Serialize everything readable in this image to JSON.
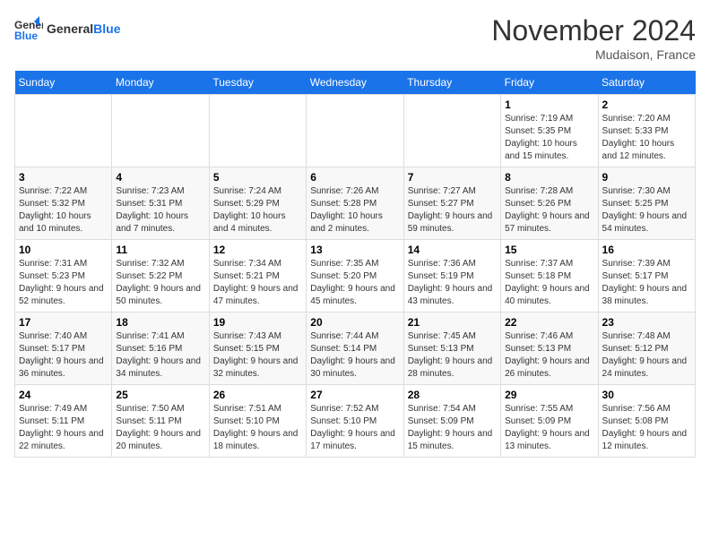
{
  "header": {
    "logo_general": "General",
    "logo_blue": "Blue",
    "month_title": "November 2024",
    "location": "Mudaison, France"
  },
  "calendar": {
    "days_of_week": [
      "Sunday",
      "Monday",
      "Tuesday",
      "Wednesday",
      "Thursday",
      "Friday",
      "Saturday"
    ],
    "weeks": [
      [
        {
          "day": "",
          "info": ""
        },
        {
          "day": "",
          "info": ""
        },
        {
          "day": "",
          "info": ""
        },
        {
          "day": "",
          "info": ""
        },
        {
          "day": "",
          "info": ""
        },
        {
          "day": "1",
          "info": "Sunrise: 7:19 AM\nSunset: 5:35 PM\nDaylight: 10 hours and 15 minutes."
        },
        {
          "day": "2",
          "info": "Sunrise: 7:20 AM\nSunset: 5:33 PM\nDaylight: 10 hours and 12 minutes."
        }
      ],
      [
        {
          "day": "3",
          "info": "Sunrise: 7:22 AM\nSunset: 5:32 PM\nDaylight: 10 hours and 10 minutes."
        },
        {
          "day": "4",
          "info": "Sunrise: 7:23 AM\nSunset: 5:31 PM\nDaylight: 10 hours and 7 minutes."
        },
        {
          "day": "5",
          "info": "Sunrise: 7:24 AM\nSunset: 5:29 PM\nDaylight: 10 hours and 4 minutes."
        },
        {
          "day": "6",
          "info": "Sunrise: 7:26 AM\nSunset: 5:28 PM\nDaylight: 10 hours and 2 minutes."
        },
        {
          "day": "7",
          "info": "Sunrise: 7:27 AM\nSunset: 5:27 PM\nDaylight: 9 hours and 59 minutes."
        },
        {
          "day": "8",
          "info": "Sunrise: 7:28 AM\nSunset: 5:26 PM\nDaylight: 9 hours and 57 minutes."
        },
        {
          "day": "9",
          "info": "Sunrise: 7:30 AM\nSunset: 5:25 PM\nDaylight: 9 hours and 54 minutes."
        }
      ],
      [
        {
          "day": "10",
          "info": "Sunrise: 7:31 AM\nSunset: 5:23 PM\nDaylight: 9 hours and 52 minutes."
        },
        {
          "day": "11",
          "info": "Sunrise: 7:32 AM\nSunset: 5:22 PM\nDaylight: 9 hours and 50 minutes."
        },
        {
          "day": "12",
          "info": "Sunrise: 7:34 AM\nSunset: 5:21 PM\nDaylight: 9 hours and 47 minutes."
        },
        {
          "day": "13",
          "info": "Sunrise: 7:35 AM\nSunset: 5:20 PM\nDaylight: 9 hours and 45 minutes."
        },
        {
          "day": "14",
          "info": "Sunrise: 7:36 AM\nSunset: 5:19 PM\nDaylight: 9 hours and 43 minutes."
        },
        {
          "day": "15",
          "info": "Sunrise: 7:37 AM\nSunset: 5:18 PM\nDaylight: 9 hours and 40 minutes."
        },
        {
          "day": "16",
          "info": "Sunrise: 7:39 AM\nSunset: 5:17 PM\nDaylight: 9 hours and 38 minutes."
        }
      ],
      [
        {
          "day": "17",
          "info": "Sunrise: 7:40 AM\nSunset: 5:17 PM\nDaylight: 9 hours and 36 minutes."
        },
        {
          "day": "18",
          "info": "Sunrise: 7:41 AM\nSunset: 5:16 PM\nDaylight: 9 hours and 34 minutes."
        },
        {
          "day": "19",
          "info": "Sunrise: 7:43 AM\nSunset: 5:15 PM\nDaylight: 9 hours and 32 minutes."
        },
        {
          "day": "20",
          "info": "Sunrise: 7:44 AM\nSunset: 5:14 PM\nDaylight: 9 hours and 30 minutes."
        },
        {
          "day": "21",
          "info": "Sunrise: 7:45 AM\nSunset: 5:13 PM\nDaylight: 9 hours and 28 minutes."
        },
        {
          "day": "22",
          "info": "Sunrise: 7:46 AM\nSunset: 5:13 PM\nDaylight: 9 hours and 26 minutes."
        },
        {
          "day": "23",
          "info": "Sunrise: 7:48 AM\nSunset: 5:12 PM\nDaylight: 9 hours and 24 minutes."
        }
      ],
      [
        {
          "day": "24",
          "info": "Sunrise: 7:49 AM\nSunset: 5:11 PM\nDaylight: 9 hours and 22 minutes."
        },
        {
          "day": "25",
          "info": "Sunrise: 7:50 AM\nSunset: 5:11 PM\nDaylight: 9 hours and 20 minutes."
        },
        {
          "day": "26",
          "info": "Sunrise: 7:51 AM\nSunset: 5:10 PM\nDaylight: 9 hours and 18 minutes."
        },
        {
          "day": "27",
          "info": "Sunrise: 7:52 AM\nSunset: 5:10 PM\nDaylight: 9 hours and 17 minutes."
        },
        {
          "day": "28",
          "info": "Sunrise: 7:54 AM\nSunset: 5:09 PM\nDaylight: 9 hours and 15 minutes."
        },
        {
          "day": "29",
          "info": "Sunrise: 7:55 AM\nSunset: 5:09 PM\nDaylight: 9 hours and 13 minutes."
        },
        {
          "day": "30",
          "info": "Sunrise: 7:56 AM\nSunset: 5:08 PM\nDaylight: 9 hours and 12 minutes."
        }
      ]
    ]
  }
}
